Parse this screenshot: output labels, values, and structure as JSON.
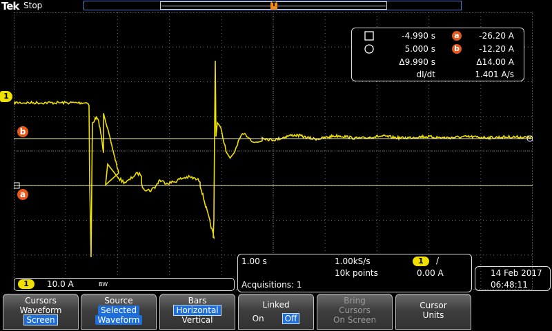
{
  "topbar": {
    "brand": "Tek",
    "run_state": "Stop"
  },
  "channel": {
    "marker": "1",
    "scale": "10.0 A",
    "bw": "BW"
  },
  "cursor_labels": {
    "a": "a",
    "b": "b"
  },
  "readout": {
    "cursor1_time": "-4.990 s",
    "cursor1_value": "-26.20 A",
    "cursor2_time": "5.000 s",
    "cursor2_value": "-12.20 A",
    "delta_time": "Δ9.990 s",
    "delta_value": "Δ14.00 A",
    "rate_label": "dI/dt",
    "rate_value": "1.401 A/s",
    "badge_a": "a",
    "badge_b": "b"
  },
  "acquisition": {
    "timebase": "1.00 s",
    "sample_rate": "1.00kS/s",
    "record_length": "10k points",
    "trigger_source": "1",
    "trigger_slope": "/",
    "trigger_level": "0.00 A",
    "acquisitions": "Acquisitions: 1"
  },
  "datetime": {
    "date": "14 Feb  2017",
    "time": "06:48:11"
  },
  "menu": {
    "cursors": {
      "title": "Cursors",
      "line2": "Waveform",
      "line3": "Screen"
    },
    "source": {
      "title": "Source",
      "line2": "Selected",
      "line3": "Waveform"
    },
    "bars": {
      "title": "Bars",
      "line2": "Horizontal",
      "line3": "Vertical"
    },
    "linked": {
      "title": "Linked",
      "on": "On",
      "off": "Off"
    },
    "bring": {
      "line1": "Bring",
      "line2": "Cursors",
      "line3": "On Screen"
    },
    "units": {
      "line1": "Cursor",
      "line2": "Units"
    }
  },
  "colors": {
    "trace": "#f0e000",
    "cursor_badge": "#e8581c",
    "selected": "#1e6fd9",
    "record_bar": "#4a7fd0"
  }
}
